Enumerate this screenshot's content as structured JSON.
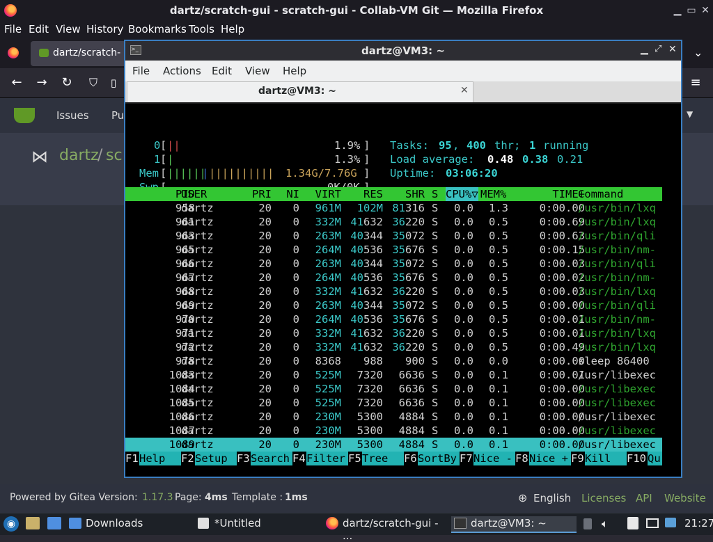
{
  "firefox": {
    "window_title": "dartz/scratch-gui - scratch-gui - Collab-VM Git — Mozilla Firefox",
    "menu": [
      "File",
      "Edit",
      "View",
      "History",
      "Bookmarks",
      "Tools",
      "Help"
    ],
    "tab_title": "dartz/scratch-"
  },
  "gitea": {
    "nav": [
      "Issues",
      "Pu"
    ],
    "repo_owner": "dartz",
    "repo_sep": "/",
    "repo_name_partial": "sc",
    "footer": {
      "powered_by": "Powered by Gitea Version:",
      "version": "1.17.3",
      "page_label": "Page:",
      "page_time": "4ms",
      "template_label": "Template :",
      "template_time": "1ms",
      "language": "English",
      "links": [
        "Licenses",
        "API",
        "Website"
      ]
    }
  },
  "terminal": {
    "window_title": "dartz@VM3: ~",
    "menu": [
      "File",
      "Actions",
      "Edit",
      "View",
      "Help"
    ],
    "tab_title": "dartz@VM3: ~",
    "htop": {
      "cpu0_label": "0",
      "cpu0_pct": "1.9%",
      "cpu1_label": "1",
      "cpu1_pct": "1.3%",
      "mem_label": "Mem",
      "mem_value": "1.34G/7.76G",
      "swp_label": "Swp",
      "swp_value": "0K/0K",
      "tasks_label": "Tasks:",
      "tasks": "95",
      "threads": "400",
      "thr_label": "thr;",
      "running": "1",
      "running_label": "running",
      "load_label": "Load average:",
      "load1": "0.48",
      "load5": "0.38",
      "load15": "0.21",
      "uptime_label": "Uptime:",
      "uptime": "03:06:20",
      "columns": [
        "PID",
        "USER",
        "PRI",
        "NI",
        "VIRT",
        "RES",
        "SHR",
        "S",
        "CPU%▽",
        "MEM%",
        "TIME+",
        "Command"
      ],
      "processes": [
        {
          "pid": "958",
          "user": "dartz",
          "pri": "20",
          "ni": "0",
          "virt": "961M",
          "res": "102M",
          "shr": "81316",
          "s": "S",
          "cpu": "0.0",
          "mem": "1.3",
          "time": "0:00.00",
          "cmd": "/usr/bin/lxq"
        },
        {
          "pid": "961",
          "user": "dartz",
          "pri": "20",
          "ni": "0",
          "virt": "332M",
          "res": "41632",
          "shr": "36220",
          "s": "S",
          "cpu": "0.0",
          "mem": "0.5",
          "time": "0:00.69",
          "cmd": "/usr/bin/lxq"
        },
        {
          "pid": "963",
          "user": "dartz",
          "pri": "20",
          "ni": "0",
          "virt": "263M",
          "res": "40344",
          "shr": "35072",
          "s": "S",
          "cpu": "0.0",
          "mem": "0.5",
          "time": "0:00.63",
          "cmd": "/usr/bin/qli"
        },
        {
          "pid": "965",
          "user": "dartz",
          "pri": "20",
          "ni": "0",
          "virt": "264M",
          "res": "40536",
          "shr": "35676",
          "s": "S",
          "cpu": "0.0",
          "mem": "0.5",
          "time": "0:00.15",
          "cmd": "/usr/bin/nm-"
        },
        {
          "pid": "966",
          "user": "dartz",
          "pri": "20",
          "ni": "0",
          "virt": "263M",
          "res": "40344",
          "shr": "35072",
          "s": "S",
          "cpu": "0.0",
          "mem": "0.5",
          "time": "0:00.03",
          "cmd": "/usr/bin/qli"
        },
        {
          "pid": "967",
          "user": "dartz",
          "pri": "20",
          "ni": "0",
          "virt": "264M",
          "res": "40536",
          "shr": "35676",
          "s": "S",
          "cpu": "0.0",
          "mem": "0.5",
          "time": "0:00.02",
          "cmd": "/usr/bin/nm-"
        },
        {
          "pid": "968",
          "user": "dartz",
          "pri": "20",
          "ni": "0",
          "virt": "332M",
          "res": "41632",
          "shr": "36220",
          "s": "S",
          "cpu": "0.0",
          "mem": "0.5",
          "time": "0:00.03",
          "cmd": "/usr/bin/lxq"
        },
        {
          "pid": "969",
          "user": "dartz",
          "pri": "20",
          "ni": "0",
          "virt": "263M",
          "res": "40344",
          "shr": "35072",
          "s": "S",
          "cpu": "0.0",
          "mem": "0.5",
          "time": "0:00.00",
          "cmd": "/usr/bin/qli"
        },
        {
          "pid": "970",
          "user": "dartz",
          "pri": "20",
          "ni": "0",
          "virt": "264M",
          "res": "40536",
          "shr": "35676",
          "s": "S",
          "cpu": "0.0",
          "mem": "0.5",
          "time": "0:00.01",
          "cmd": "/usr/bin/nm-"
        },
        {
          "pid": "971",
          "user": "dartz",
          "pri": "20",
          "ni": "0",
          "virt": "332M",
          "res": "41632",
          "shr": "36220",
          "s": "S",
          "cpu": "0.0",
          "mem": "0.5",
          "time": "0:00.01",
          "cmd": "/usr/bin/lxq"
        },
        {
          "pid": "972",
          "user": "dartz",
          "pri": "20",
          "ni": "0",
          "virt": "332M",
          "res": "41632",
          "shr": "36220",
          "s": "S",
          "cpu": "0.0",
          "mem": "0.5",
          "time": "0:00.49",
          "cmd": "/usr/bin/lxq"
        },
        {
          "pid": "978",
          "user": "dartz",
          "pri": "20",
          "ni": "0",
          "virt": "8368",
          "res": "988",
          "shr": "900",
          "s": "S",
          "cpu": "0.0",
          "mem": "0.0",
          "time": "0:00.00",
          "cmd": "sleep 86400"
        },
        {
          "pid": "1083",
          "user": "dartz",
          "pri": "20",
          "ni": "0",
          "virt": "525M",
          "res": "7320",
          "shr": "6636",
          "s": "S",
          "cpu": "0.0",
          "mem": "0.1",
          "time": "0:00.01",
          "cmd": "/usr/libexec"
        },
        {
          "pid": "1084",
          "user": "dartz",
          "pri": "20",
          "ni": "0",
          "virt": "525M",
          "res": "7320",
          "shr": "6636",
          "s": "S",
          "cpu": "0.0",
          "mem": "0.1",
          "time": "0:00.00",
          "cmd": "/usr/libexec"
        },
        {
          "pid": "1085",
          "user": "dartz",
          "pri": "20",
          "ni": "0",
          "virt": "525M",
          "res": "7320",
          "shr": "6636",
          "s": "S",
          "cpu": "0.0",
          "mem": "0.1",
          "time": "0:00.00",
          "cmd": "/usr/libexec"
        },
        {
          "pid": "1086",
          "user": "dartz",
          "pri": "20",
          "ni": "0",
          "virt": "230M",
          "res": "5300",
          "shr": "4884",
          "s": "S",
          "cpu": "0.0",
          "mem": "0.1",
          "time": "0:00.00",
          "cmd": "/usr/libexec"
        },
        {
          "pid": "1087",
          "user": "dartz",
          "pri": "20",
          "ni": "0",
          "virt": "230M",
          "res": "5300",
          "shr": "4884",
          "s": "S",
          "cpu": "0.0",
          "mem": "0.1",
          "time": "0:00.00",
          "cmd": "/usr/libexec"
        },
        {
          "pid": "1089",
          "user": "dartz",
          "pri": "20",
          "ni": "0",
          "virt": "230M",
          "res": "5300",
          "shr": "4884",
          "s": "S",
          "cpu": "0.0",
          "mem": "0.1",
          "time": "0:00.00",
          "cmd": "/usr/libexec"
        }
      ],
      "selected_row": 17,
      "fkeys": [
        {
          "key": "F1",
          "label": "Help"
        },
        {
          "key": "F2",
          "label": "Setup"
        },
        {
          "key": "F3",
          "label": "Search"
        },
        {
          "key": "F4",
          "label": "Filter"
        },
        {
          "key": "F5",
          "label": "Tree"
        },
        {
          "key": "F6",
          "label": "SortBy"
        },
        {
          "key": "F7",
          "label": "Nice -"
        },
        {
          "key": "F8",
          "label": "Nice +"
        },
        {
          "key": "F9",
          "label": "Kill"
        },
        {
          "key": "F10",
          "label": "Qu"
        }
      ]
    }
  },
  "taskbar": {
    "items": [
      "Downloads",
      "*Untitled",
      "dartz/scratch-gui - ...",
      "dartz@VM3: ~"
    ],
    "clock": "21:27"
  },
  "colors": {
    "htop_header_bg": "#33c633",
    "htop_selected_bg": "#39c0c0",
    "terminal_border": "#3a7ec2"
  }
}
